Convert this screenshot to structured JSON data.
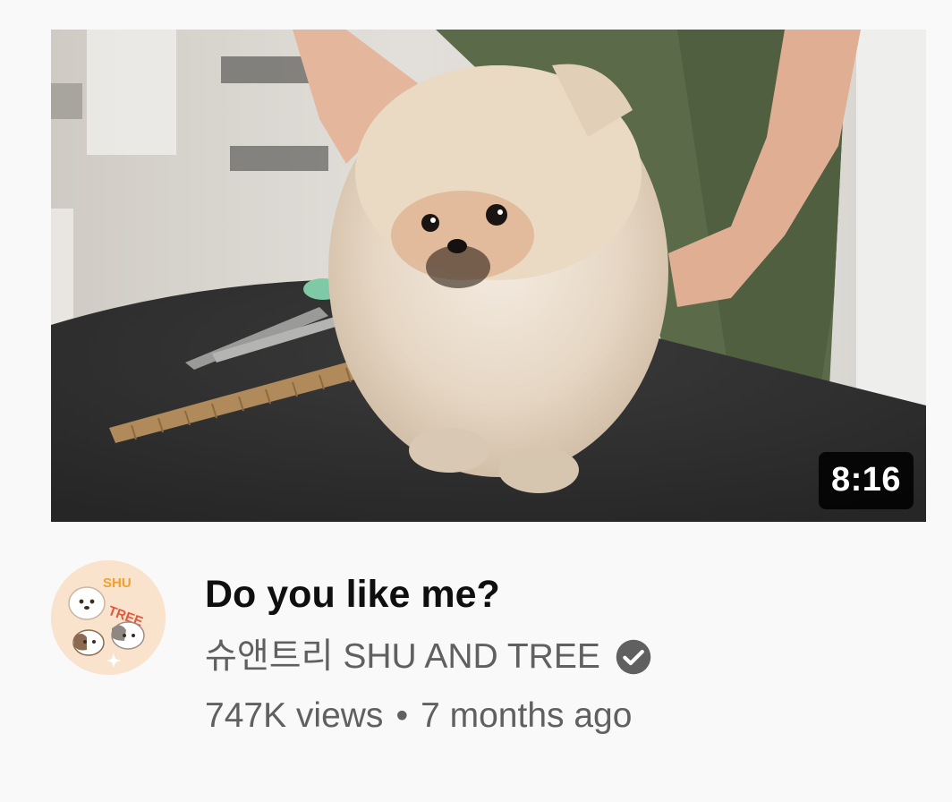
{
  "video": {
    "duration": "8:16",
    "title": "Do you like me?",
    "channel": "슈앤트리 SHU AND TREE",
    "views": "747K views",
    "separator": "•",
    "age": "7 months ago"
  },
  "avatar": {
    "line1": "SHU",
    "line2": "TREE"
  },
  "icons": {
    "verified": "verified-check-icon"
  },
  "colors": {
    "background": "#f9f9f9",
    "title": "#0f0f0f",
    "secondary_text": "#606060",
    "duration_badge": "#000000"
  }
}
